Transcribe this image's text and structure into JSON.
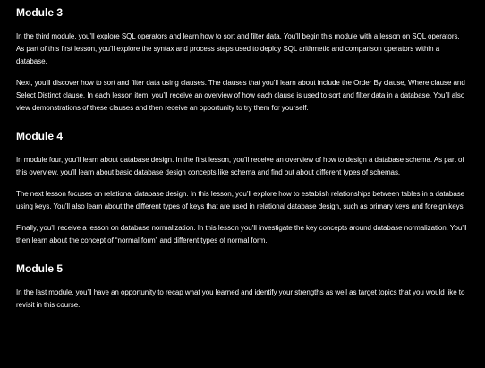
{
  "modules": [
    {
      "heading": "Module 3",
      "paragraphs": [
        "In the third module, you’ll explore SQL operators and learn how to sort and filter data. You’ll begin this module with a lesson on SQL operators. As part of this first lesson, you’ll explore the syntax and process steps used to deploy SQL arithmetic and comparison operators within a database.",
        "Next, you’ll discover how to sort and filter data using clauses. The clauses that you’ll learn about include the Order By clause, Where clause and Select Distinct clause. In each lesson item, you’ll receive an overview of how each clause is used to sort and filter data in a database. You’ll also view demonstrations of these clauses and then receive an opportunity to try them for yourself."
      ]
    },
    {
      "heading": "Module 4",
      "paragraphs": [
        "In module four, you’ll learn about database design. In the first lesson, you’ll receive an overview of how to design a database schema. As part of this overview, you’ll learn about basic database design concepts like schema and find out about different types of schemas.",
        "The next lesson focuses on relational database design. In this lesson, you’ll explore how to establish relationships between tables in a database using keys. You’ll also learn about the different types of keys that are used in relational database design, such as primary keys and foreign keys.",
        "Finally, you’ll receive a lesson on database normalization. In this lesson you’ll investigate the key concepts around database normalization. You’ll then learn about the concept of “normal form” and different types of normal form."
      ]
    },
    {
      "heading": "Module 5",
      "paragraphs": [
        "In the last module, you’ll have an opportunity to recap what you learned and identify your strengths as well as target topics that you would like to revisit in this course."
      ]
    }
  ]
}
